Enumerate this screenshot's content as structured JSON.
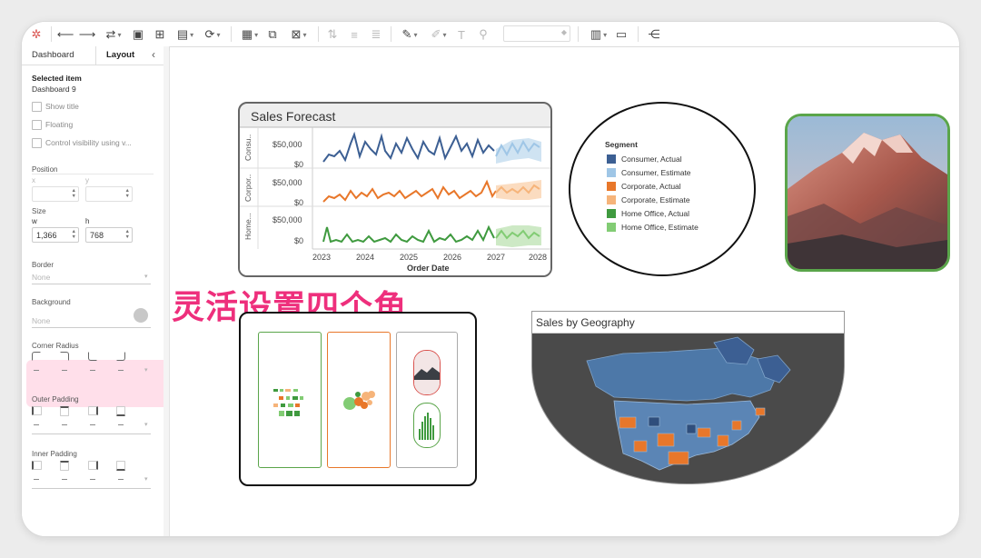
{
  "panel": {
    "tabs": [
      "Dashboard",
      "Layout"
    ],
    "selected_label": "Selected item",
    "selected_value": "Dashboard 9",
    "show_title": "Show title",
    "floating": "Floating",
    "control_visibility": "Control visibility using v...",
    "position_label": "Position",
    "x_label": "x",
    "y_label": "y",
    "size_label": "Size",
    "w_label": "w",
    "h_label": "h",
    "w_value": "1,366",
    "h_value": "768",
    "border_label": "Border",
    "border_value": "None",
    "background_label": "Background",
    "background_value": "None",
    "corner_radius_label": "Corner Radius",
    "outer_padding_label": "Outer Padding",
    "inner_padding_label": "Inner Padding"
  },
  "forecast": {
    "title": "Sales Forecast",
    "rows": [
      "Consu..",
      "Corpor..",
      "Home..."
    ],
    "yticks": [
      "$50,000",
      "$0"
    ],
    "xticks": [
      "2023",
      "2024",
      "2025",
      "2026",
      "2027",
      "2028"
    ],
    "xlabel": "Order Date"
  },
  "legend": {
    "title": "Segment",
    "items": [
      {
        "label": "Consumer, Actual",
        "color": "#3c5f93"
      },
      {
        "label": "Consumer, Estimate",
        "color": "#9fc6e6"
      },
      {
        "label": "Corporate, Actual",
        "color": "#e8772a"
      },
      {
        "label": "Corporate, Estimate",
        "color": "#f6b47a"
      },
      {
        "label": "Home Office, Actual",
        "color": "#3f9a3f"
      },
      {
        "label": "Home Office, Estimate",
        "color": "#82cc74"
      }
    ]
  },
  "callout": "灵活设置四个角",
  "geo": {
    "title": "Sales by Geography"
  },
  "colors": {
    "accent_pink": "#ee2f7c",
    "photo_border": "#5aa54a"
  }
}
